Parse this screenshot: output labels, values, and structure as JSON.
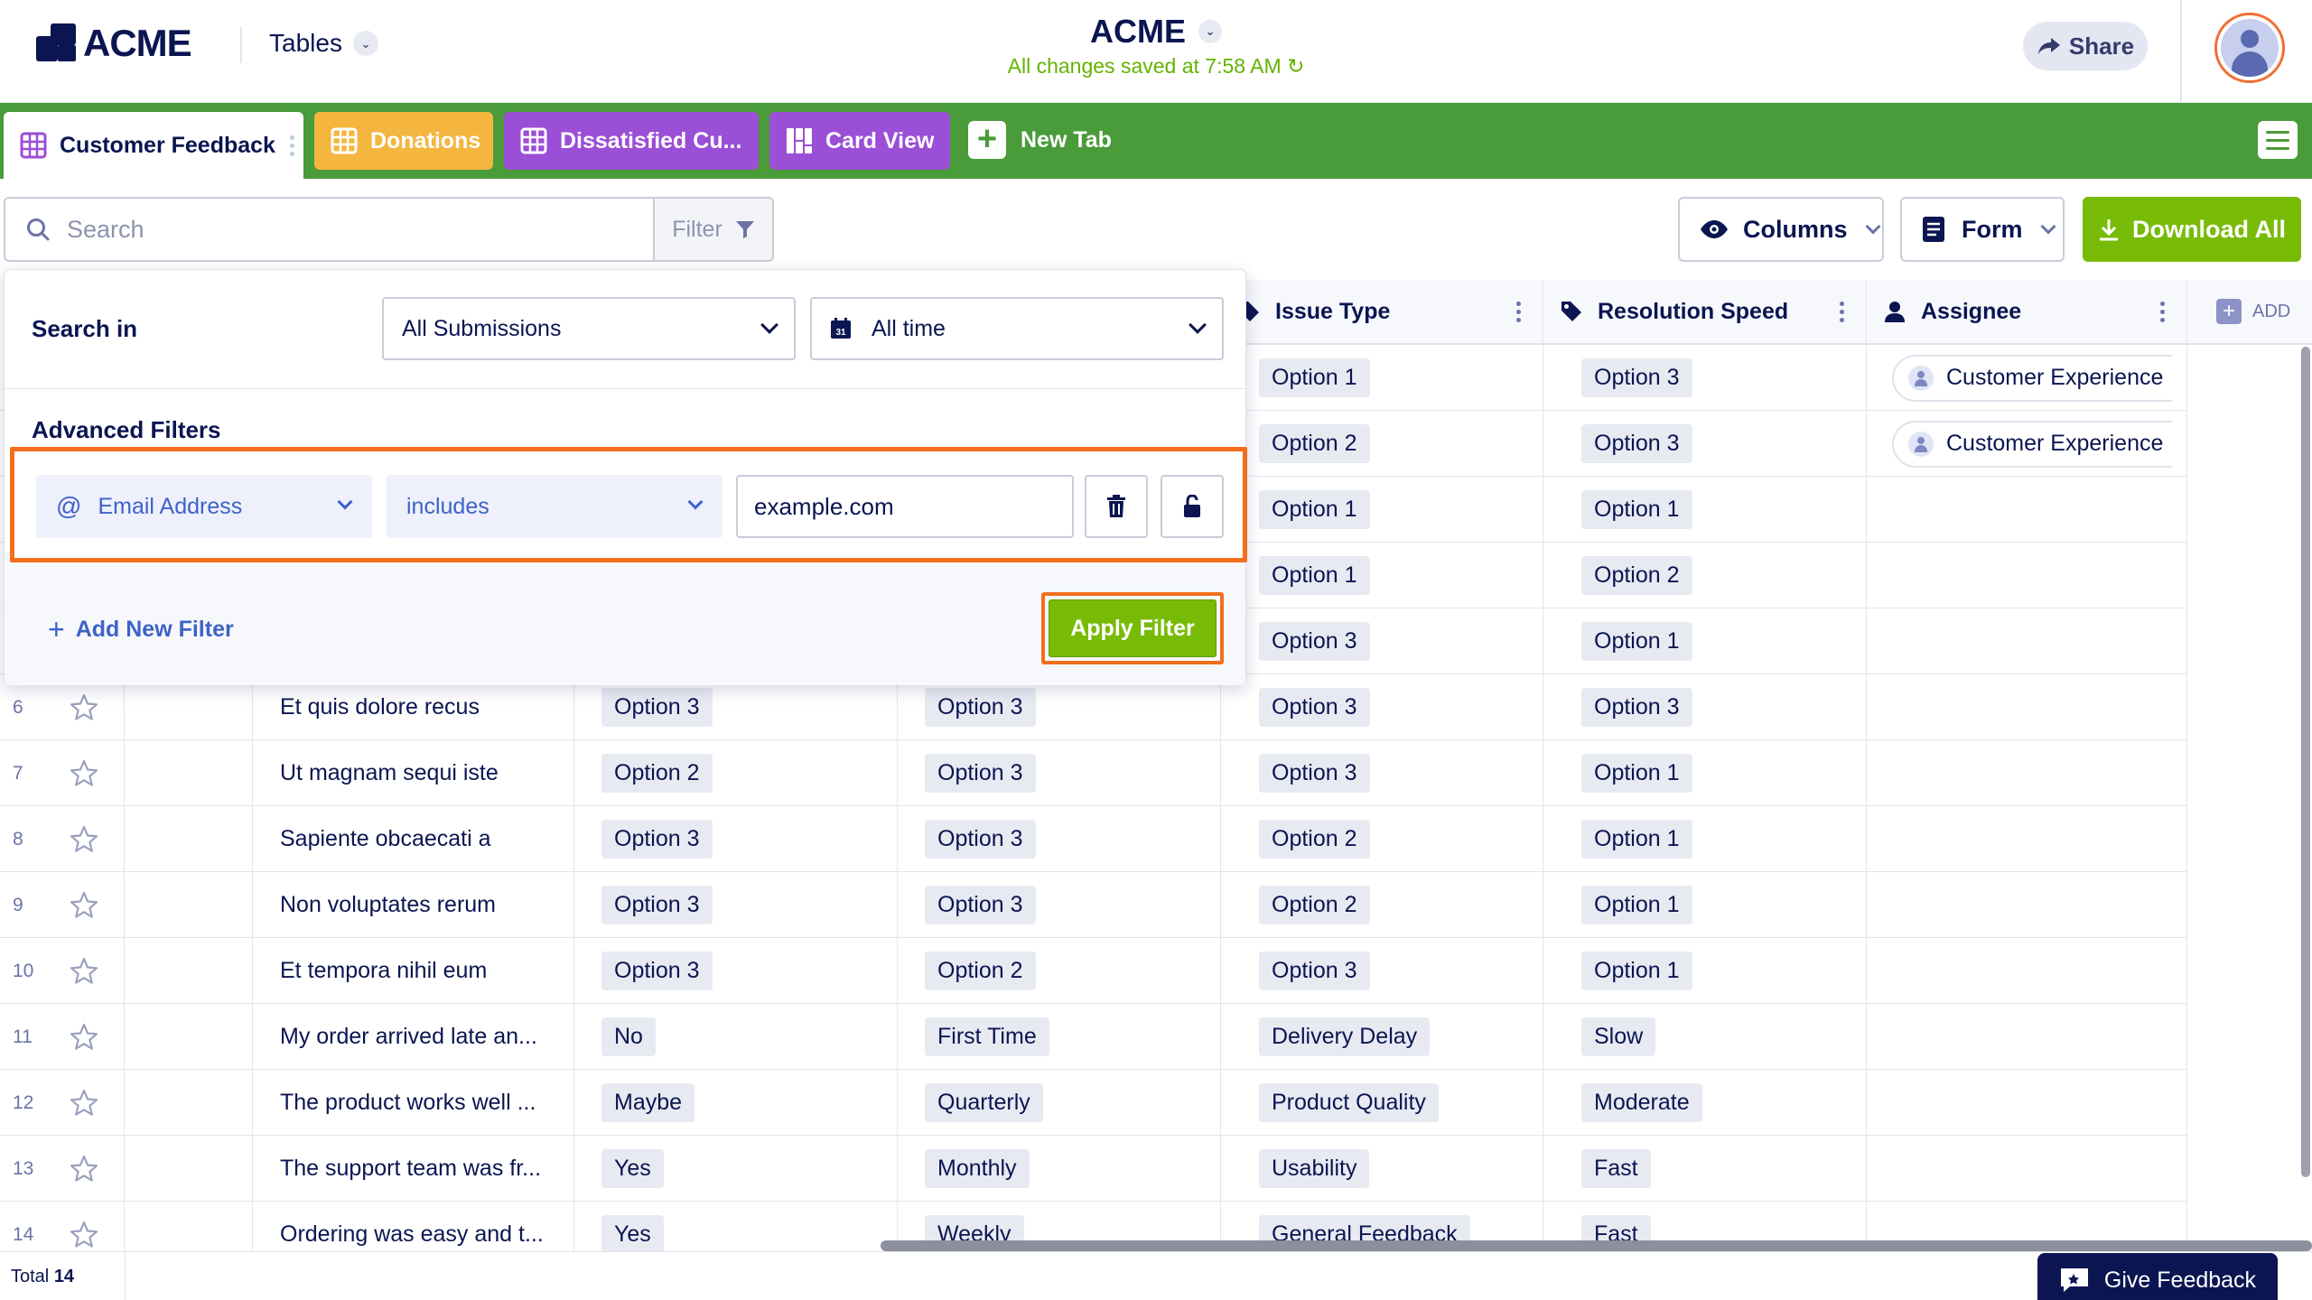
{
  "header": {
    "logo": "ACME",
    "menu_label": "Tables",
    "title": "ACME",
    "saved_status": "All changes saved at 7:58 AM",
    "share_label": "Share"
  },
  "tabs": [
    {
      "label": "Customer Feedback",
      "color": "#ffffff"
    },
    {
      "label": "Donations",
      "color": "#f4b63f"
    },
    {
      "label": "Dissatisfied Cu...",
      "color": "#9b4ed6"
    },
    {
      "label": "Card View",
      "color": "#9b4ed6"
    }
  ],
  "new_tab_label": "New Tab",
  "toolbar": {
    "search_placeholder": "Search",
    "filter_label": "Filter",
    "columns_label": "Columns",
    "form_label": "Form",
    "download_label": "Download All"
  },
  "columns": {
    "issue_type": "Issue Type",
    "resolution_speed": "Resolution Speed",
    "assignee": "Assignee",
    "add": "ADD"
  },
  "rows": [
    {
      "num": "",
      "text": "",
      "c3": "",
      "c4": "",
      "issue": "Option 1",
      "speed": "Option 3",
      "assignee": "Customer Experience"
    },
    {
      "num": "",
      "text": "",
      "c3": "",
      "c4": "",
      "issue": "Option 2",
      "speed": "Option 3",
      "assignee": "Customer Experience"
    },
    {
      "num": "",
      "text": "",
      "c3": "",
      "c4": "",
      "issue": "Option 1",
      "speed": "Option 1",
      "assignee": ""
    },
    {
      "num": "",
      "text": "",
      "c3": "",
      "c4": "",
      "issue": "Option 1",
      "speed": "Option 2",
      "assignee": ""
    },
    {
      "num": "",
      "text": "",
      "c3": "",
      "c4": "",
      "issue": "Option 3",
      "speed": "Option 1",
      "assignee": ""
    },
    {
      "num": "6",
      "text": "Et quis dolore recus",
      "c3": "Option 3",
      "c4": "Option 3",
      "issue": "Option 3",
      "speed": "Option 3",
      "assignee": ""
    },
    {
      "num": "7",
      "text": "Ut magnam sequi iste",
      "c3": "Option 2",
      "c4": "Option 3",
      "issue": "Option 3",
      "speed": "Option 1",
      "assignee": ""
    },
    {
      "num": "8",
      "text": "Sapiente obcaecati a",
      "c3": "Option 3",
      "c4": "Option 3",
      "issue": "Option 2",
      "speed": "Option 1",
      "assignee": ""
    },
    {
      "num": "9",
      "text": "Non voluptates rerum",
      "c3": "Option 3",
      "c4": "Option 3",
      "issue": "Option 2",
      "speed": "Option 1",
      "assignee": ""
    },
    {
      "num": "10",
      "text": "Et tempora nihil eum",
      "c3": "Option 3",
      "c4": "Option 2",
      "issue": "Option 3",
      "speed": "Option 1",
      "assignee": ""
    },
    {
      "num": "11",
      "text": "My order arrived late an...",
      "c3": "No",
      "c4": "First Time",
      "issue": "Delivery Delay",
      "speed": "Slow",
      "assignee": ""
    },
    {
      "num": "12",
      "text": "The product works well ...",
      "c3": "Maybe",
      "c4": "Quarterly",
      "issue": "Product Quality",
      "speed": "Moderate",
      "assignee": ""
    },
    {
      "num": "13",
      "text": "The support team was fr...",
      "c3": "Yes",
      "c4": "Monthly",
      "issue": "Usability",
      "speed": "Fast",
      "assignee": ""
    },
    {
      "num": "14",
      "text": "Ordering was easy and t...",
      "c3": "Yes",
      "c4": "Weekly",
      "issue": "General Feedback",
      "speed": "Fast",
      "assignee": ""
    }
  ],
  "footer": {
    "total_label": "Total",
    "total_count": "14",
    "feedback_label": "Give Feedback"
  },
  "filter_popover": {
    "search_in_label": "Search in",
    "submissions_value": "All Submissions",
    "time_value": "All time",
    "advanced_label": "Advanced Filters",
    "field_value": "Email Address",
    "operator_value": "includes",
    "filter_value": "example.com",
    "add_filter_label": "Add New Filter",
    "apply_label": "Apply Filter"
  },
  "colors": {
    "tabbar": "#4a9b3a",
    "accent_green": "#78bb07",
    "highlight_orange": "#f26e1c",
    "navy": "#0a1551"
  }
}
